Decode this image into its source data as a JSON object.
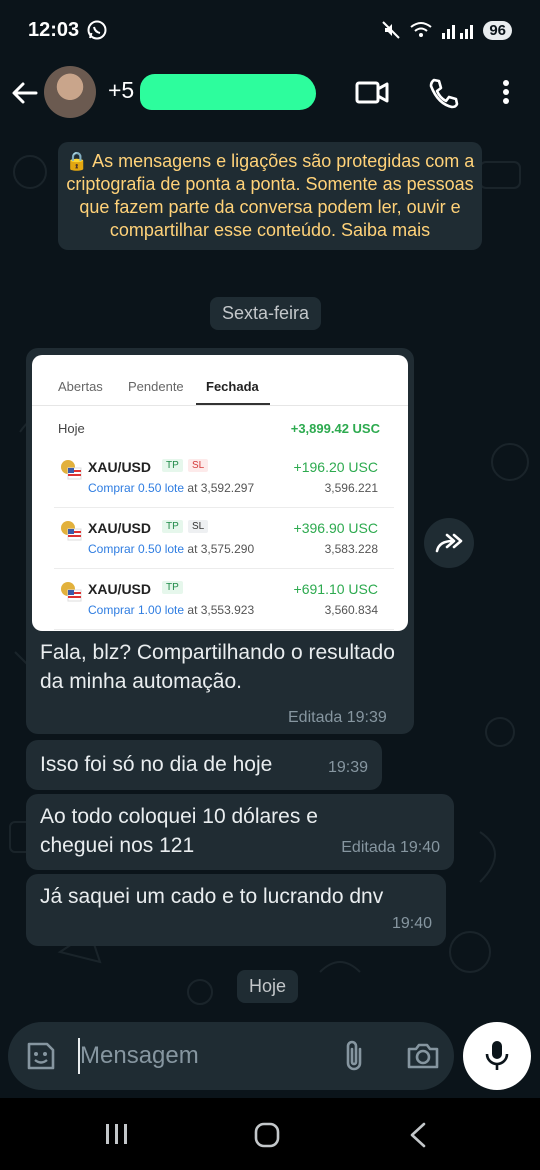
{
  "status": {
    "time": "12:03",
    "battery": "96"
  },
  "header": {
    "contact_name_prefix": "+5"
  },
  "encryption_notice": "🔒 As mensagens e ligações são protegidas com a criptografia de ponta a ponta. Somente as pessoas que fazem parte da conversa podem ler, ouvir e compartilhar esse conteúdo. Saiba mais",
  "dates": {
    "first": "Sexta-feira",
    "second": "Hoje"
  },
  "screenshot": {
    "tabs": [
      "Abertas",
      "Pendente",
      "Fechada"
    ],
    "active_tab": "Fechada",
    "today_label": "Hoje",
    "today_total": "+3,899.42 USC",
    "trades": [
      {
        "symbol": "XAU/USD",
        "tags": [
          "TP",
          "SL"
        ],
        "pnl": "+196.20 USC",
        "action": "Comprar 0.50 lote",
        "open": "at 3,592.297",
        "close": "3,596.221"
      },
      {
        "symbol": "XAU/USD",
        "tags": [
          "TP",
          "SL"
        ],
        "pnl": "+396.90 USC",
        "action": "Comprar 0.50 lote",
        "open": "at 3,575.290",
        "close": "3,583.228"
      },
      {
        "symbol": "XAU/USD",
        "tags": [
          "TP"
        ],
        "pnl": "+691.10 USC",
        "action": "Comprar 1.00 lote",
        "open": "at 3,553.923",
        "close": "3,560.834"
      }
    ]
  },
  "messages": [
    {
      "text": "Fala, blz? Compartilhando o resultado da minha automação.",
      "meta": "Editada 19:39"
    },
    {
      "text": "Isso foi só no dia de hoje",
      "meta": "19:39"
    },
    {
      "text": "Ao todo coloquei 10 dólares e cheguei nos 121",
      "meta": "Editada 19:40"
    },
    {
      "text": "Já saquei um cado e to lucrando dnv",
      "meta": "19:40"
    }
  ],
  "composer": {
    "placeholder": "Mensagem"
  },
  "colors": {
    "accent_mask": "#2dfd9d",
    "notice_text": "#ffd279",
    "bubble": "#202c33",
    "profit": "#2daa4f"
  }
}
